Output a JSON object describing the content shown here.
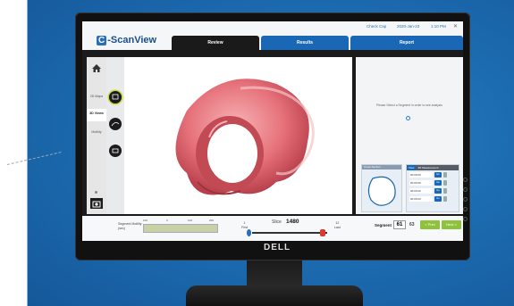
{
  "window": {
    "user": "Check Cap",
    "date": "2020-Jan-23",
    "time": "1:10 PM",
    "close": "✕"
  },
  "app": {
    "logo_letter": "C",
    "logo_text": "-ScanView"
  },
  "tabs": [
    {
      "label": "Review",
      "active": true
    },
    {
      "label": "Results",
      "active": false
    },
    {
      "label": "Report",
      "active": false
    }
  ],
  "left_nav": {
    "home_icon": "home-icon",
    "items": [
      {
        "label": "2D Maps",
        "active": false
      },
      {
        "label": "3D Views",
        "active": true
      },
      {
        "label": "Motility",
        "active": false
      }
    ],
    "bottom_icon": "camera-icon"
  },
  "tools": [
    {
      "label": "Surface",
      "icon": "surface-view-icon",
      "active": true
    },
    {
      "label": "Slice",
      "icon": "slice-view-icon",
      "active": false
    },
    {
      "label": "Fly",
      "icon": "fly-through-icon",
      "active": false
    }
  ],
  "right_panel": {
    "message": "Please Select a Segment in order to see analysis",
    "cross_section_title": "Cross Section",
    "measure_tabs": [
      "View",
      "3D Measurement"
    ],
    "measurements": [
      {
        "value": "00:00:00",
        "button": "Go"
      },
      {
        "value": "00:00:00",
        "button": "Go"
      },
      {
        "value": "00:00:00",
        "button": "Go"
      },
      {
        "value": "00:00:00",
        "button": "Go"
      }
    ]
  },
  "bottom_bar": {
    "segment_label_line1": "Segment Motility",
    "segment_label_line2": "(sec)",
    "segment_ticks": [
      "100",
      "0",
      "100",
      "200"
    ],
    "first_label": "First",
    "first_num": "1",
    "slice_label": "Slice",
    "slice_value": "1480",
    "last_label": "Last",
    "last_num": "12",
    "segment_label": "Segment",
    "segment_value": "61",
    "segment_total": "63",
    "prev_label": "< Prev",
    "next_label": "Next >"
  },
  "monitor": {
    "brand": "DELL"
  },
  "colors": {
    "accent_blue": "#1a67b5",
    "tab_active": "#1a1a1a",
    "model_pink": "#e8737a",
    "nav_green": "#8fc23c"
  }
}
